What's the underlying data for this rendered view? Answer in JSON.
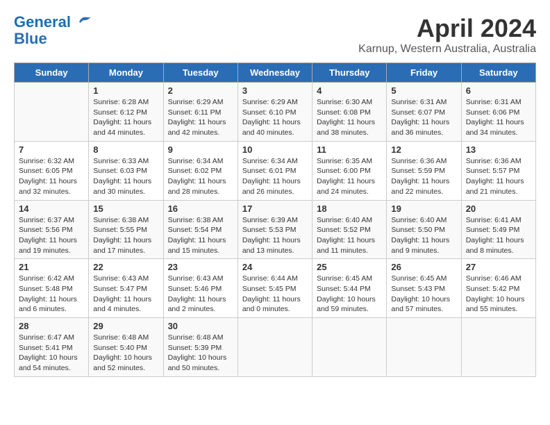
{
  "header": {
    "logo_line1": "General",
    "logo_line2": "Blue",
    "month": "April 2024",
    "location": "Karnup, Western Australia, Australia"
  },
  "weekdays": [
    "Sunday",
    "Monday",
    "Tuesday",
    "Wednesday",
    "Thursday",
    "Friday",
    "Saturday"
  ],
  "weeks": [
    [
      {
        "day": "",
        "info": ""
      },
      {
        "day": "1",
        "info": "Sunrise: 6:28 AM\nSunset: 6:12 PM\nDaylight: 11 hours\nand 44 minutes."
      },
      {
        "day": "2",
        "info": "Sunrise: 6:29 AM\nSunset: 6:11 PM\nDaylight: 11 hours\nand 42 minutes."
      },
      {
        "day": "3",
        "info": "Sunrise: 6:29 AM\nSunset: 6:10 PM\nDaylight: 11 hours\nand 40 minutes."
      },
      {
        "day": "4",
        "info": "Sunrise: 6:30 AM\nSunset: 6:08 PM\nDaylight: 11 hours\nand 38 minutes."
      },
      {
        "day": "5",
        "info": "Sunrise: 6:31 AM\nSunset: 6:07 PM\nDaylight: 11 hours\nand 36 minutes."
      },
      {
        "day": "6",
        "info": "Sunrise: 6:31 AM\nSunset: 6:06 PM\nDaylight: 11 hours\nand 34 minutes."
      }
    ],
    [
      {
        "day": "7",
        "info": "Sunrise: 6:32 AM\nSunset: 6:05 PM\nDaylight: 11 hours\nand 32 minutes."
      },
      {
        "day": "8",
        "info": "Sunrise: 6:33 AM\nSunset: 6:03 PM\nDaylight: 11 hours\nand 30 minutes."
      },
      {
        "day": "9",
        "info": "Sunrise: 6:34 AM\nSunset: 6:02 PM\nDaylight: 11 hours\nand 28 minutes."
      },
      {
        "day": "10",
        "info": "Sunrise: 6:34 AM\nSunset: 6:01 PM\nDaylight: 11 hours\nand 26 minutes."
      },
      {
        "day": "11",
        "info": "Sunrise: 6:35 AM\nSunset: 6:00 PM\nDaylight: 11 hours\nand 24 minutes."
      },
      {
        "day": "12",
        "info": "Sunrise: 6:36 AM\nSunset: 5:59 PM\nDaylight: 11 hours\nand 22 minutes."
      },
      {
        "day": "13",
        "info": "Sunrise: 6:36 AM\nSunset: 5:57 PM\nDaylight: 11 hours\nand 21 minutes."
      }
    ],
    [
      {
        "day": "14",
        "info": "Sunrise: 6:37 AM\nSunset: 5:56 PM\nDaylight: 11 hours\nand 19 minutes."
      },
      {
        "day": "15",
        "info": "Sunrise: 6:38 AM\nSunset: 5:55 PM\nDaylight: 11 hours\nand 17 minutes."
      },
      {
        "day": "16",
        "info": "Sunrise: 6:38 AM\nSunset: 5:54 PM\nDaylight: 11 hours\nand 15 minutes."
      },
      {
        "day": "17",
        "info": "Sunrise: 6:39 AM\nSunset: 5:53 PM\nDaylight: 11 hours\nand 13 minutes."
      },
      {
        "day": "18",
        "info": "Sunrise: 6:40 AM\nSunset: 5:52 PM\nDaylight: 11 hours\nand 11 minutes."
      },
      {
        "day": "19",
        "info": "Sunrise: 6:40 AM\nSunset: 5:50 PM\nDaylight: 11 hours\nand 9 minutes."
      },
      {
        "day": "20",
        "info": "Sunrise: 6:41 AM\nSunset: 5:49 PM\nDaylight: 11 hours\nand 8 minutes."
      }
    ],
    [
      {
        "day": "21",
        "info": "Sunrise: 6:42 AM\nSunset: 5:48 PM\nDaylight: 11 hours\nand 6 minutes."
      },
      {
        "day": "22",
        "info": "Sunrise: 6:43 AM\nSunset: 5:47 PM\nDaylight: 11 hours\nand 4 minutes."
      },
      {
        "day": "23",
        "info": "Sunrise: 6:43 AM\nSunset: 5:46 PM\nDaylight: 11 hours\nand 2 minutes."
      },
      {
        "day": "24",
        "info": "Sunrise: 6:44 AM\nSunset: 5:45 PM\nDaylight: 11 hours\nand 0 minutes."
      },
      {
        "day": "25",
        "info": "Sunrise: 6:45 AM\nSunset: 5:44 PM\nDaylight: 10 hours\nand 59 minutes."
      },
      {
        "day": "26",
        "info": "Sunrise: 6:45 AM\nSunset: 5:43 PM\nDaylight: 10 hours\nand 57 minutes."
      },
      {
        "day": "27",
        "info": "Sunrise: 6:46 AM\nSunset: 5:42 PM\nDaylight: 10 hours\nand 55 minutes."
      }
    ],
    [
      {
        "day": "28",
        "info": "Sunrise: 6:47 AM\nSunset: 5:41 PM\nDaylight: 10 hours\nand 54 minutes."
      },
      {
        "day": "29",
        "info": "Sunrise: 6:48 AM\nSunset: 5:40 PM\nDaylight: 10 hours\nand 52 minutes."
      },
      {
        "day": "30",
        "info": "Sunrise: 6:48 AM\nSunset: 5:39 PM\nDaylight: 10 hours\nand 50 minutes."
      },
      {
        "day": "",
        "info": ""
      },
      {
        "day": "",
        "info": ""
      },
      {
        "day": "",
        "info": ""
      },
      {
        "day": "",
        "info": ""
      }
    ]
  ]
}
